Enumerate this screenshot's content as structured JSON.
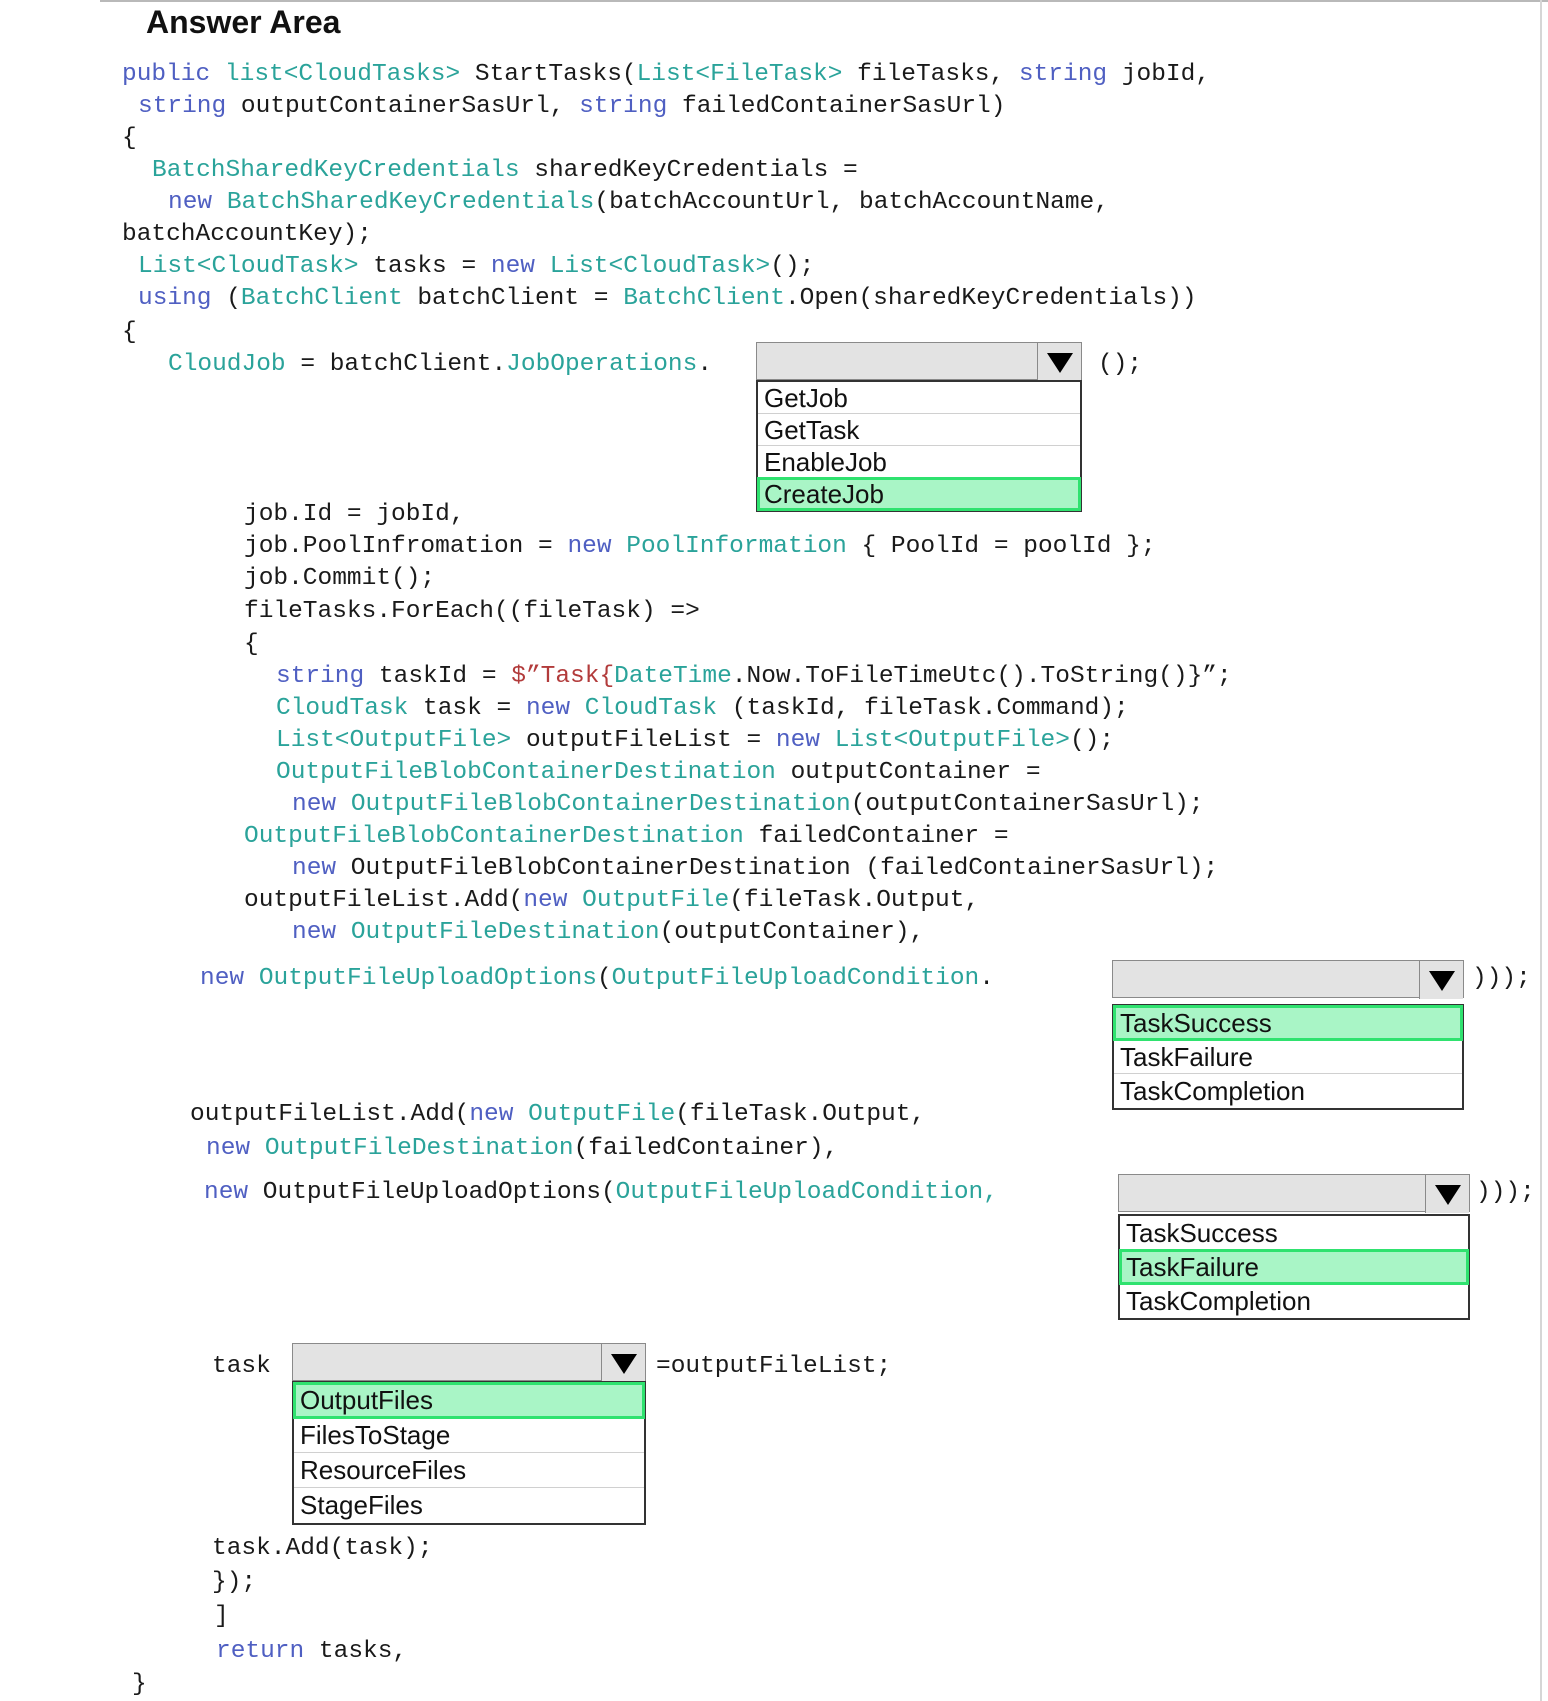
{
  "title": "Answer Area",
  "code": {
    "l1": {
      "a": "public",
      "b": "list<CloudTasks>",
      "c": " StartTasks(",
      "d": "List<FileTask>",
      "e": " fileTasks, ",
      "f": "string",
      "g": " jobId,"
    },
    "l2": {
      "a": "string",
      "b": " outputContainerSasUrl, ",
      "c": "string",
      "d": " failedContainerSasUrl)"
    },
    "l3": "{",
    "l4": {
      "a": "BatchSharedKeyCredentials",
      "b": " sharedKeyCredentials ="
    },
    "l5": {
      "a": "new",
      "b": "BatchSharedKeyCredentials",
      "c": "(batchAccountUrl, batchAccountName,"
    },
    "l6": "batchAccountKey);",
    "l7": {
      "a": "List<CloudTask>",
      "b": " tasks = ",
      "c": "new",
      "d": "List<CloudTask>",
      "e": "();"
    },
    "l8": {
      "a": "using",
      "b": " (",
      "c": "BatchClient",
      "d": " batchClient = ",
      "e": "BatchClient",
      "f": ".Open(sharedKeyCredentials))"
    },
    "l9": "{",
    "l10": {
      "a": "CloudJob",
      "b": " = batchClient.",
      "c": "JobOperations",
      "d": "."
    },
    "l10_tail": "();",
    "l11": "job.Id = jobId,",
    "l12": {
      "a": "job.PoolInfromation = ",
      "b": "new",
      "c": "PoolInformation",
      "d": " { PoolId = poolId };"
    },
    "l13": "job.Commit();",
    "l14": "fileTasks.ForEach((fileTask) =>",
    "l15": "{",
    "l16": {
      "a": "string",
      "b": " taskId = ",
      "c": "$”Task{",
      "d": "DateTime",
      "e": ".Now.ToFileTimeUtc().ToString()}”;"
    },
    "l17": {
      "a": "CloudTask",
      "b": " task = ",
      "c": "new",
      "d": "CloudTask",
      "e": " (taskId, fileTask.Command);"
    },
    "l18": {
      "a": "List<OutputFile>",
      "b": " outputFileList = ",
      "c": "new",
      "d": "List<OutputFile>",
      "e": "();"
    },
    "l19": {
      "a": "OutputFileBlobContainerDestination",
      "b": " outputContainer ="
    },
    "l20": {
      "a": "new",
      "b": "OutputFileBlobContainerDestination",
      "c": "(outputContainerSasUrl);"
    },
    "l21": {
      "a": "OutputFileBlobContainerDestination",
      "b": " failedContainer ="
    },
    "l22": {
      "a": "new",
      "b": " OutputFileBlobContainerDestination (failedContainerSasUrl);"
    },
    "l23": {
      "a": "outputFileList.Add(",
      "b": "new",
      "c": "OutputFile",
      "d": "(fileTask.Output,"
    },
    "l24": {
      "a": "new",
      "b": "OutputFileDestination",
      "c": "(outputContainer),"
    },
    "l25": {
      "a": "new",
      "b": "OutputFileUploadOptions",
      "c": "(",
      "d": "OutputFileUploadCondition",
      "e": "."
    },
    "l25_tail": ")));",
    "l26": {
      "a": "outputFileList.Add(",
      "b": "new",
      "c": "OutputFile",
      "d": "(fileTask.Output,"
    },
    "l27": {
      "a": "new",
      "b": "OutputFileDestination",
      "c": "(failedContainer),"
    },
    "l28": {
      "a": "new",
      "b": " OutputFileUploadOptions(",
      "c": "OutputFileUploadCondition,"
    },
    "l28_tail": ")));",
    "l29": "task",
    "l29_tail": "=outputFileList;",
    "l30": "task.Add(task);",
    "l31": "});",
    "l32": "]",
    "l33": {
      "a": "return",
      "b": " tasks,"
    },
    "l34": "}"
  },
  "dropdowns": {
    "job_ops": {
      "options": [
        "GetJob",
        "GetTask",
        "EnableJob",
        "CreateJob"
      ],
      "selected": "CreateJob"
    },
    "upload_cond_1": {
      "options": [
        "TaskSuccess",
        "TaskFailure",
        "TaskCompletion"
      ],
      "selected": "TaskSuccess"
    },
    "upload_cond_2": {
      "options": [
        "TaskSuccess",
        "TaskFailure",
        "TaskCompletion"
      ],
      "selected": "TaskFailure"
    },
    "task_prop": {
      "options": [
        "OutputFiles",
        "FilesToStage",
        "ResourceFiles",
        "StageFiles"
      ],
      "selected": "OutputFiles"
    }
  },
  "colors": {
    "keyword": "#4f5fc2",
    "type": "#2aa39a",
    "string": "#b23b3b",
    "selection_fill": "#a9f5c6",
    "selection_border": "#2fe26f"
  }
}
